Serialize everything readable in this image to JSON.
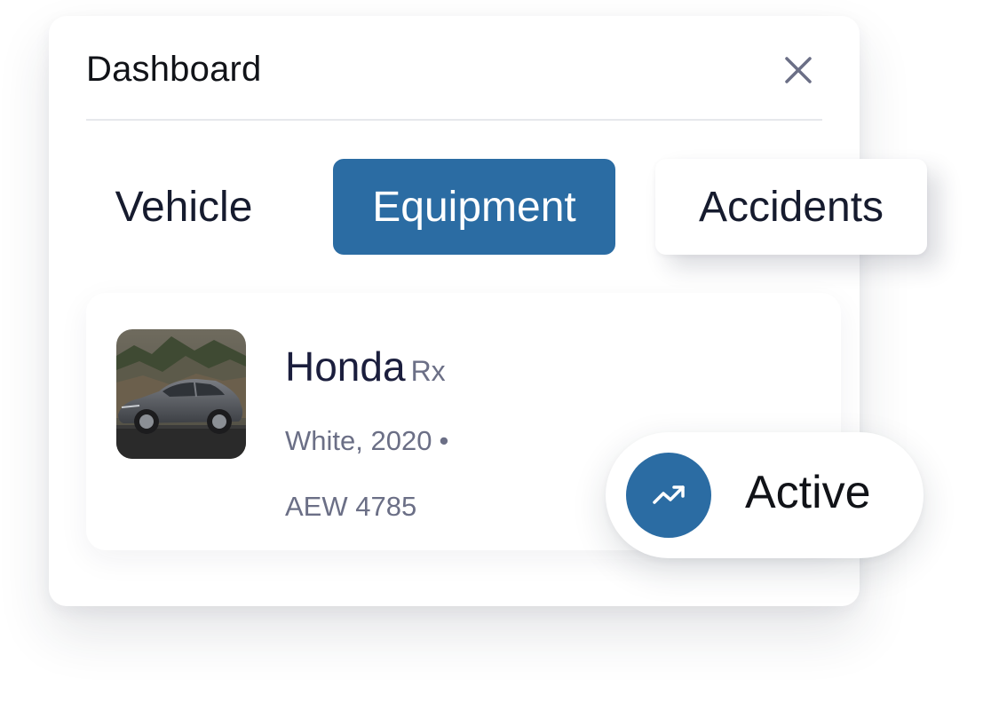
{
  "header": {
    "title": "Dashboard"
  },
  "tabs": {
    "vehicle": "Vehicle",
    "equipment": "Equipment",
    "accidents": "Accidents"
  },
  "vehicle": {
    "make": "Honda",
    "model": "Rx",
    "color_year": "White, 2020",
    "separator": "•",
    "plate": "AEW 4785"
  },
  "status": {
    "label": "Active",
    "icon": "trending-up-icon"
  },
  "colors": {
    "accent": "#2b6ca3",
    "muted_text": "#6b6f86",
    "dark_text": "#1b1e3d"
  }
}
